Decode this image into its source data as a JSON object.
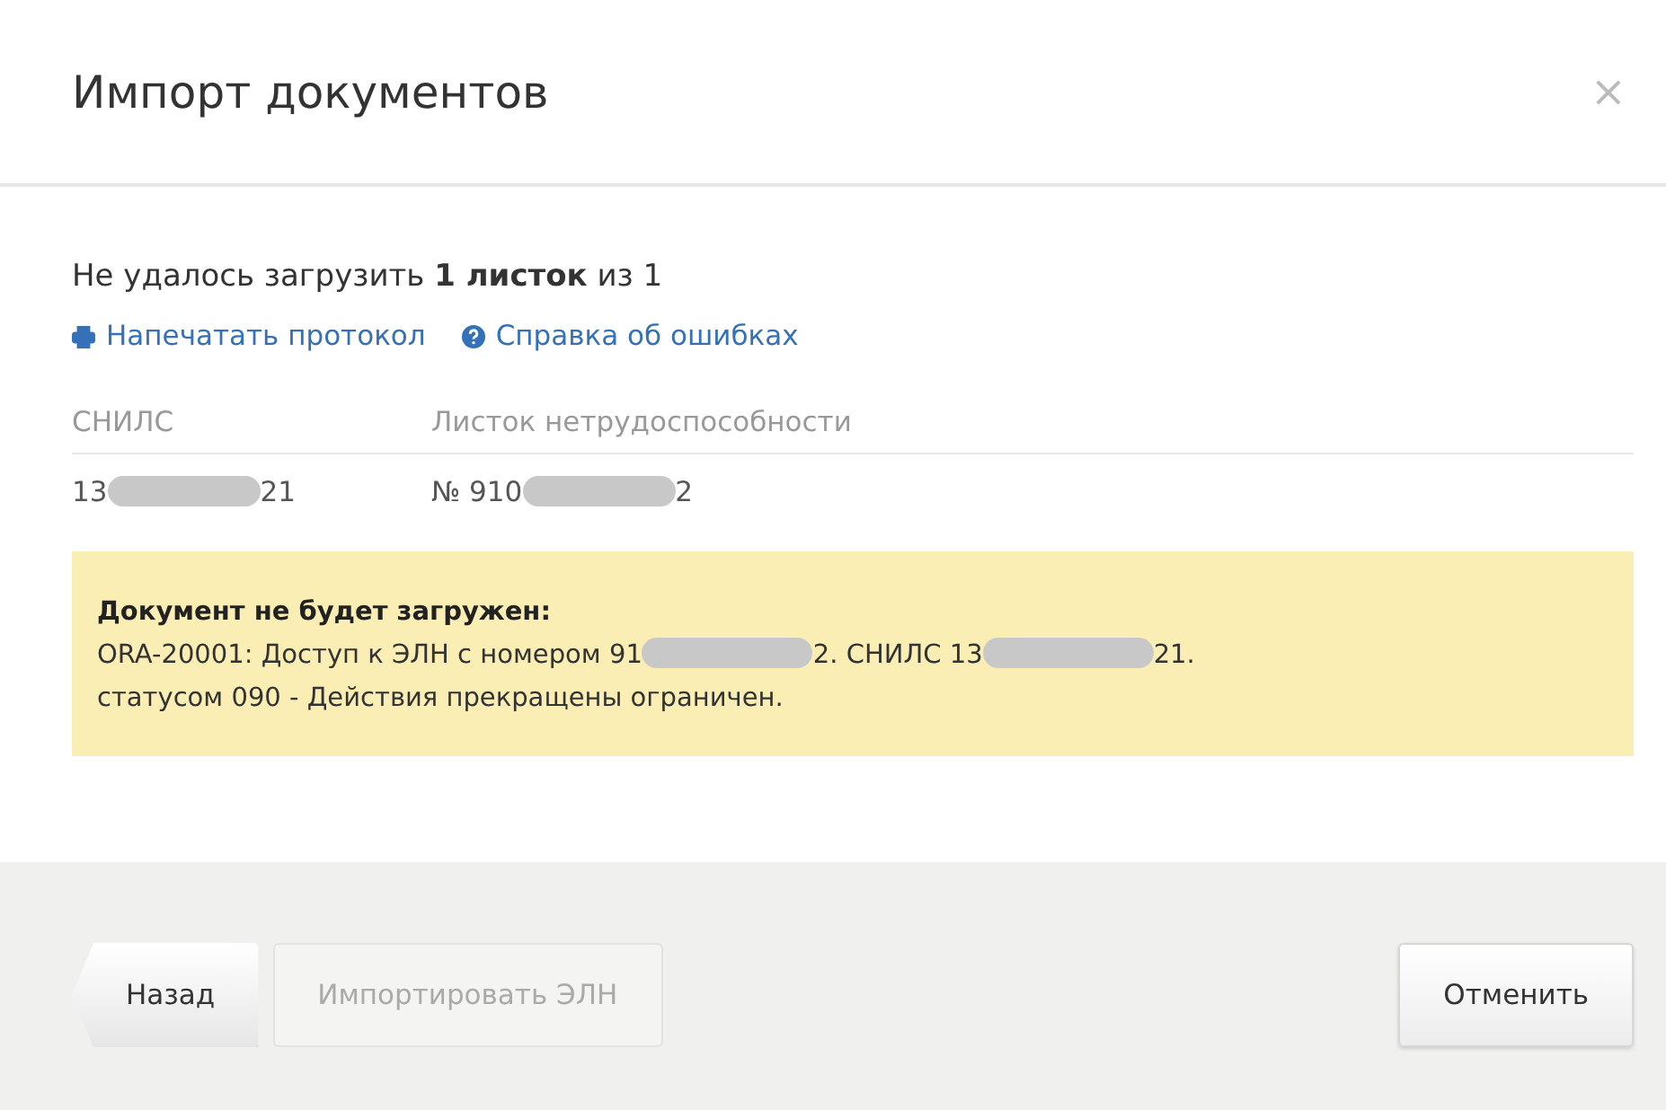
{
  "dialog": {
    "title": "Импорт документов",
    "close": "×"
  },
  "summary": "Не удалось загрузить **1 листок** из 1",
  "links": [
    {
      "kind": "print",
      "label": "Напечатать протокол"
    },
    {
      "kind": "help",
      "label": "Справка об ошибках"
    }
  ],
  "table": {
    "columns": [
      "СНИЛС",
      "Листок нетрудоспособности"
    ],
    "rows": [
      [
        [
          {
            "kind": "text",
            "text": "13"
          },
          {
            "kind": "mask"
          },
          {
            "kind": "text",
            "text": "21"
          }
        ],
        [
          {
            "kind": "text",
            "text": "№ 910"
          },
          {
            "kind": "mask"
          },
          {
            "kind": "text",
            "text": "2"
          }
        ]
      ]
    ]
  },
  "warning": {
    "title": "Документ не будет загружен:",
    "message": [
      {
        "kind": "text",
        "text": "ORA-20001: Доступ к ЭЛН с номером 91"
      },
      {
        "kind": "mask"
      },
      {
        "kind": "text",
        "text": "2. СНИЛС 13"
      },
      {
        "kind": "mask"
      },
      {
        "kind": "text",
        "text": "21."
      },
      {
        "kind": "text",
        "text": "статусом 090 - Действия прекращены ограничен."
      }
    ]
  },
  "footer": {
    "buttons": [
      {
        "kind": "back",
        "label": "Назад",
        "disabled": false
      },
      {
        "kind": "normal",
        "label": "Импортировать ЭЛН",
        "disabled": true
      },
      {
        "kind": "spacer"
      },
      {
        "kind": "normal",
        "label": "Отменить",
        "disabled": false
      }
    ]
  }
}
